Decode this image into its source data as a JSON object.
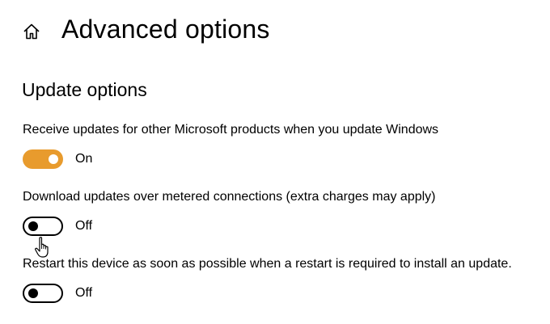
{
  "header": {
    "home_icon": "home-icon",
    "title": "Advanced options"
  },
  "section": {
    "title": "Update options"
  },
  "settings": [
    {
      "label": "Receive updates for other Microsoft products when you update Windows",
      "state": "On",
      "enabled": true
    },
    {
      "label": "Download updates over metered connections (extra charges may apply)",
      "state": "Off",
      "enabled": false
    },
    {
      "label": "Restart this device as soon as possible when a restart is required to install an update.",
      "state": "Off",
      "enabled": false
    }
  ],
  "colors": {
    "accent": "#e89b2d",
    "text": "#000000",
    "background": "#ffffff"
  },
  "cursor": {
    "icon": "hand-pointer-icon"
  }
}
